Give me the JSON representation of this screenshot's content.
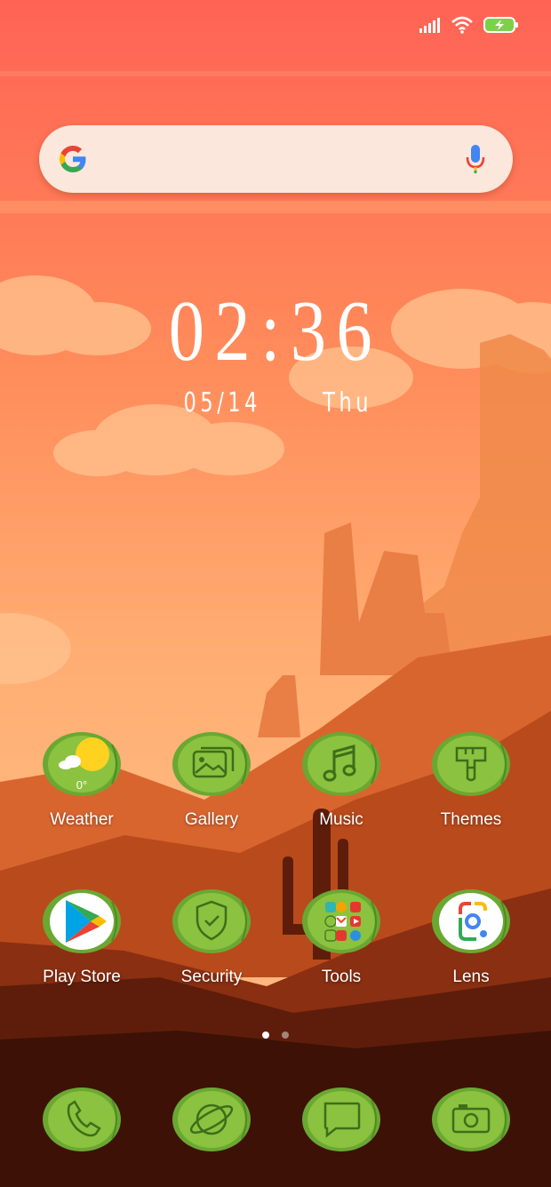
{
  "status_bar": {
    "signal_icon": "signal-bars-icon",
    "wifi_icon": "wifi-icon",
    "battery_icon": "battery-charging-icon"
  },
  "search": {
    "logo": "google-g-icon",
    "voice_icon": "microphone-icon"
  },
  "clock": {
    "time": "02:36",
    "date": "05/14",
    "weekday": "Thu"
  },
  "home_apps": [
    {
      "label": "Weather",
      "icon": "weather-icon",
      "temp": "0°"
    },
    {
      "label": "Gallery",
      "icon": "gallery-icon"
    },
    {
      "label": "Music",
      "icon": "music-note-icon"
    },
    {
      "label": "Themes",
      "icon": "paintbrush-icon"
    },
    {
      "label": "Play Store",
      "icon": "play-store-icon"
    },
    {
      "label": "Security",
      "icon": "shield-check-icon"
    },
    {
      "label": "Tools",
      "icon": "tools-folder-icon"
    },
    {
      "label": "Lens",
      "icon": "google-lens-icon"
    }
  ],
  "page_indicator": {
    "pages": 2,
    "active": 1
  },
  "dock": [
    {
      "name": "Phone",
      "icon": "phone-icon"
    },
    {
      "name": "Browser",
      "icon": "globe-orbit-icon"
    },
    {
      "name": "Messages",
      "icon": "message-bubble-icon"
    },
    {
      "name": "Camera",
      "icon": "camera-icon"
    }
  ],
  "colors": {
    "cactus_green": "#8bc23f",
    "cactus_dark": "#5c9a28",
    "sky_top": "#ff6455",
    "sky_mid": "#ff9a5e"
  }
}
